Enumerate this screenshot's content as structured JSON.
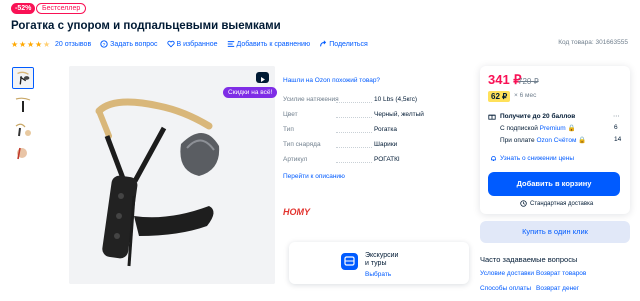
{
  "header": {
    "discount_badge": "-52%",
    "bestseller_badge": "Бестселлер",
    "title": "Рогатка с упором и подпальцевыми выемками"
  },
  "actions": {
    "rating_stars": 4.5,
    "reviews": "20 отзывов",
    "ask_question": "Задать вопрос",
    "favorites": "В избранное",
    "compare": "Добавить к сравнению",
    "share": "Поделиться",
    "product_code": "Код товара: 301663555"
  },
  "media": {
    "fast_badge": "Скидки на всё!",
    "video_icon": "video-icon"
  },
  "specs": {
    "cheaper_link": "Нашли на Ozon похожий товар?",
    "rows": [
      {
        "label": "Усилие натяжения",
        "value": "10 Lbs (4,5кгс)"
      },
      {
        "label": "Цвет",
        "value": "Черный, желтый"
      },
      {
        "label": "Тип",
        "value": "Рогатка"
      },
      {
        "label": "Тип снаряда",
        "value": "Шарики"
      },
      {
        "label": "Артикул",
        "value": "РОГАТКI"
      }
    ],
    "desc_link": "Перейти к описанию",
    "brand": "HOMY"
  },
  "excursions": {
    "title_line1": "Экскурсии",
    "title_line2": "и туры",
    "cta": "Выбрать"
  },
  "buy": {
    "price": "341 ₽",
    "old_price": "720 ₽",
    "installment": "62 ₽",
    "installment_term": "× 6 мес",
    "bonus": "Получите до 20 баллов",
    "sub_premium_prefix": "С подпиской",
    "sub_premium_link": "Premium",
    "sub_premium_value": "6",
    "sub_card_prefix": "При оплате",
    "sub_card_link": "Ozon Счётом",
    "sub_card_value": "14",
    "notify": "Узнать о снижении цены",
    "add_to_cart": "Добавить в корзину",
    "delivery": "Стандартная доставка",
    "one_click": "Купить в один клик"
  },
  "faq": {
    "title": "Часто задаваемые вопросы",
    "links": [
      "Условие доставки",
      "Возврат товаров",
      "Способы оплаты",
      "Возврат денег"
    ]
  },
  "colors": {
    "accent": "#005bff",
    "price": "#f91155",
    "badge_purple": "#7f2de6",
    "installment": "#ffe15a"
  }
}
